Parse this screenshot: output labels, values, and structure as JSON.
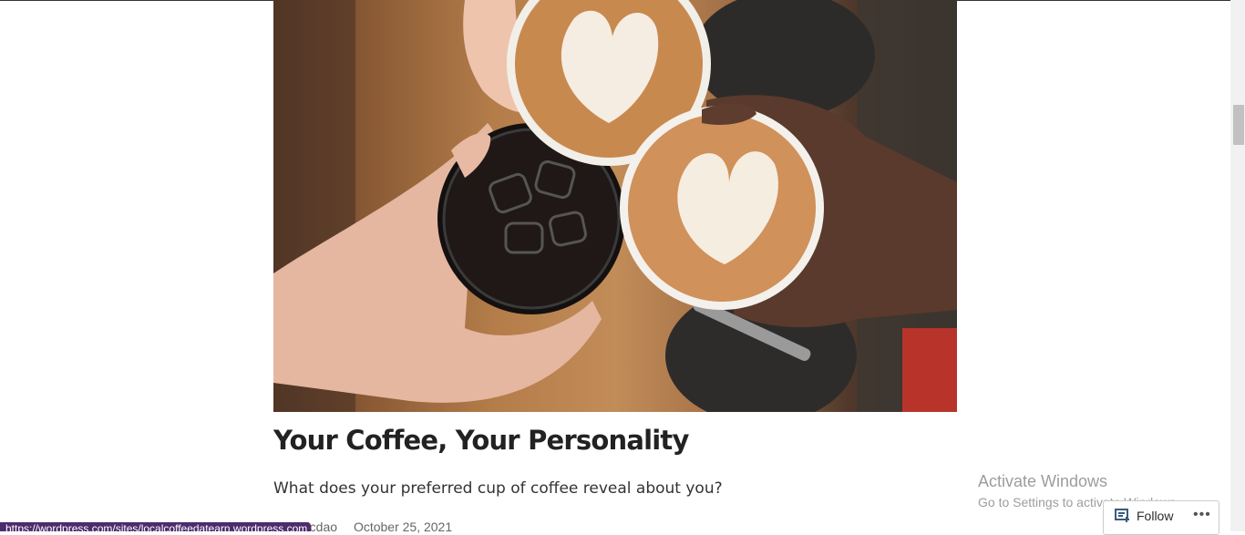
{
  "post": {
    "title": "Your Coffee, Your Personality",
    "excerpt": "What does your preferred cup of coffee reveal about you?",
    "author_partial": "tine Nicdao",
    "date": "October 25, 2021"
  },
  "status_bar": {
    "url": "https://wordpress.com/sites/localcoffeedatearn.wordpress.com"
  },
  "windows_watermark": {
    "line1": "Activate Windows",
    "line2": "Go to Settings to activate Windows."
  },
  "follow_bar": {
    "follow_label": "Follow",
    "more_label": "•••",
    "follow_icon": "reader-follow-icon"
  }
}
